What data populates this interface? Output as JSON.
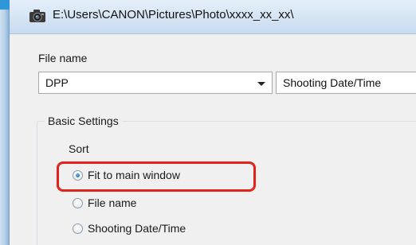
{
  "window": {
    "title": "E:\\Users\\CANON\\Pictures\\Photo\\xxxx_xx_xx\\",
    "icon": "camera-icon"
  },
  "file_name": {
    "label": "File name",
    "prefix_value": "DPP",
    "suffix_value": "Shooting Date/Time"
  },
  "basic_settings": {
    "title": "Basic Settings",
    "sort": {
      "label": "Sort",
      "options": [
        {
          "label": "Fit to main window",
          "selected": true
        },
        {
          "label": "File name",
          "selected": false
        },
        {
          "label": "Shooting Date/Time",
          "selected": false
        }
      ]
    }
  },
  "colors": {
    "highlight": "#e2231a",
    "title_bar": "#d6e5f5",
    "dialog_background": "#f0f0f0"
  }
}
